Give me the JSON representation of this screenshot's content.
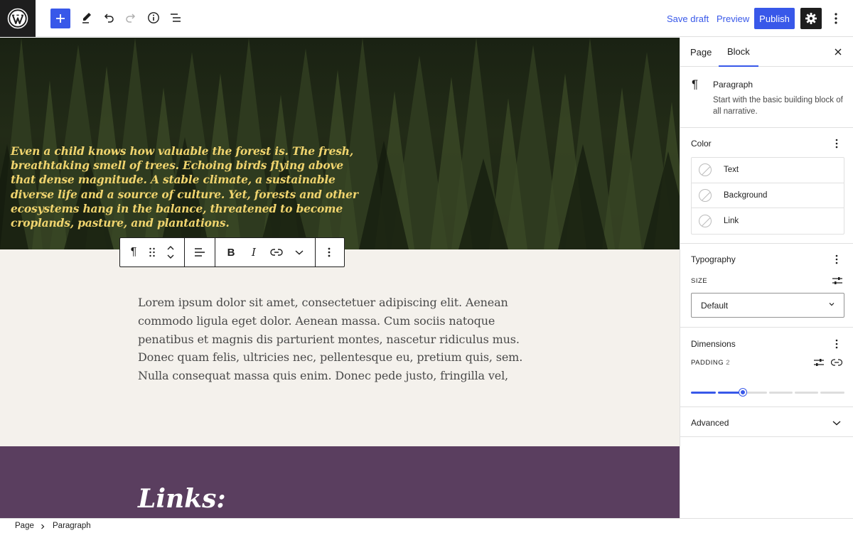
{
  "toolbar": {
    "save_draft_label": "Save draft",
    "preview_label": "Preview",
    "publish_label": "Publish",
    "accent_color": "#3858e9",
    "icons": [
      "wordpress-logo",
      "plus-icon",
      "pen-icon",
      "undo-icon",
      "redo-icon",
      "info-icon",
      "list-view-icon",
      "gear-icon",
      "more-vertical-icon"
    ]
  },
  "canvas": {
    "cover_quote": "Even a child knows how valuable the forest is. The fresh, breathtaking smell of trees. Echoing birds flying above that dense magnitude. A stable climate, a sustainable diverse life and a source of culture. Yet, forests and other ecosystems hang in the balance, threatened to become croplands, pasture, and plantations.",
    "paragraph": "Lorem ipsum dolor sit amet, consectetuer adipiscing elit. Aenean commodo ligula eget dolor. Aenean massa. Cum sociis natoque penatibus et magnis dis parturient montes, nascetur ridiculus mus. Donec quam felis, ultricies nec, pellentesque eu, pretium quis, sem. Nulla consequat massa quis enim. Donec pede justo, fringilla vel,",
    "links_heading": "Links:",
    "quote_color": "#f0d46e",
    "purple_color": "#5a3e5f",
    "background_color": "#f4f1ec"
  },
  "sidebar": {
    "tabs": [
      {
        "label": "Page",
        "active": false
      },
      {
        "label": "Block",
        "active": true
      }
    ],
    "block": {
      "title": "Paragraph",
      "description": "Start with the basic building block of all narrative."
    },
    "color_panel": {
      "title": "Color",
      "items": [
        "Text",
        "Background",
        "Link"
      ]
    },
    "typography_panel": {
      "title": "Typography",
      "size_label": "SIZE",
      "size_value": "Default"
    },
    "dimensions_panel": {
      "title": "Dimensions",
      "padding_label": "PADDING",
      "padding_value": "2"
    },
    "advanced_panel": {
      "title": "Advanced"
    }
  },
  "footer": {
    "breadcrumbs": [
      "Page",
      "Paragraph"
    ]
  }
}
